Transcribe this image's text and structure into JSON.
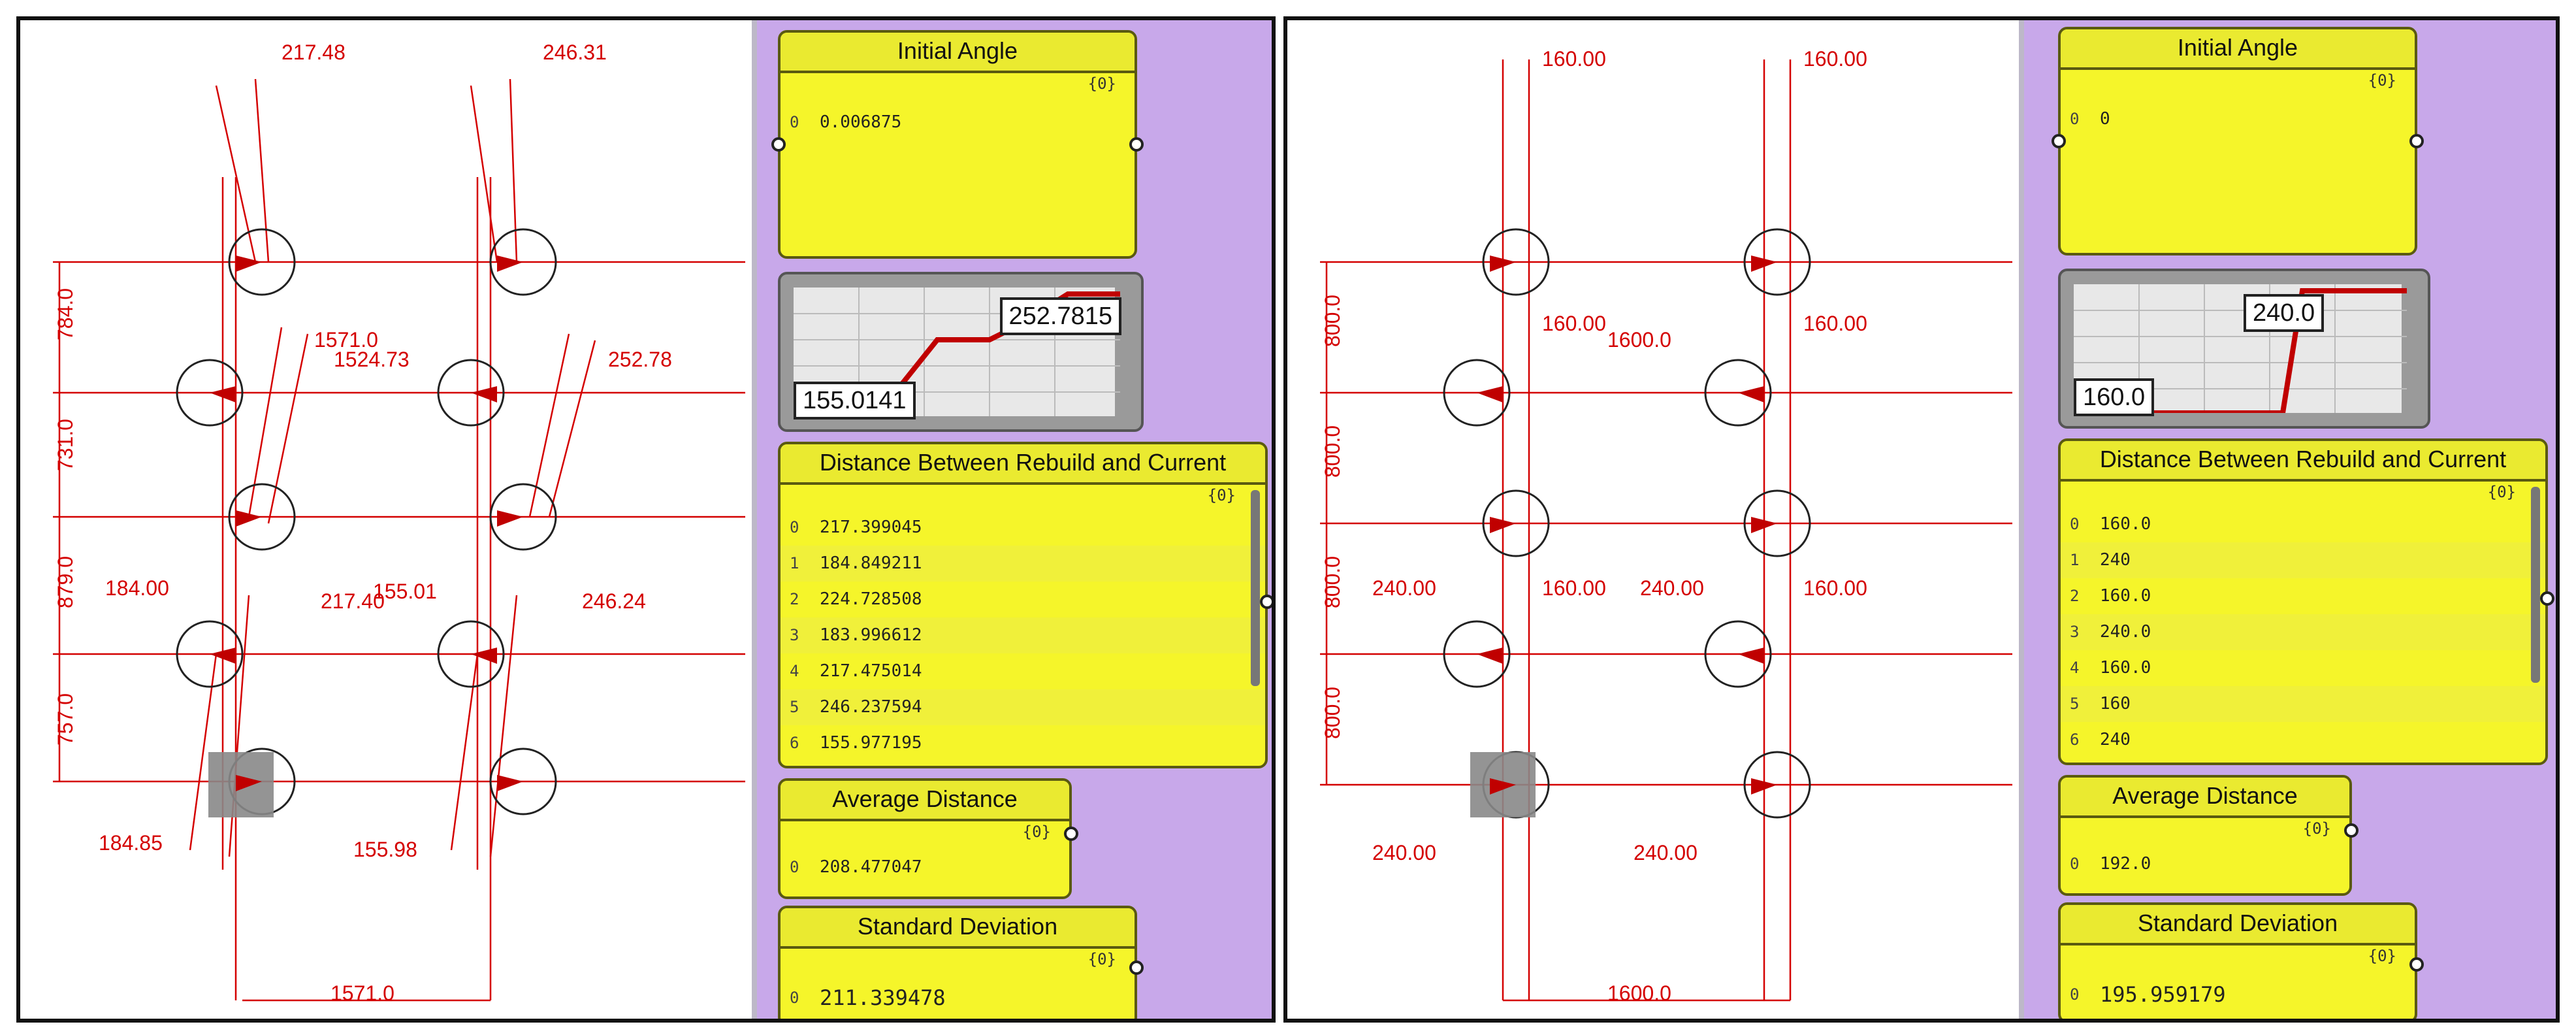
{
  "left": {
    "dims_top": [
      "217.48",
      "246.31"
    ],
    "dims_mid": [
      "1571.0",
      "1524.73",
      "252.78"
    ],
    "dims_low": [
      "184.00",
      "217.40",
      "155.01",
      "246.24"
    ],
    "dims_bottom": [
      "184.85",
      "155.98"
    ],
    "dims_vertical": [
      "784.0",
      "731.0",
      "879.0",
      "757.0"
    ],
    "dim_width": "1571.0",
    "initial_angle": {
      "title": "Initial Angle",
      "path": "{0}",
      "rows": [
        {
          "i": "0",
          "v": "0.006875"
        }
      ]
    },
    "graph": {
      "min_label": "155.0141",
      "max_label": "252.7815"
    },
    "distance": {
      "title": "Distance Between Rebuild and Current",
      "path": "{0}",
      "rows": [
        {
          "i": "0",
          "v": "217.399045"
        },
        {
          "i": "1",
          "v": "184.849211"
        },
        {
          "i": "2",
          "v": "224.728508"
        },
        {
          "i": "3",
          "v": "183.996612"
        },
        {
          "i": "4",
          "v": "217.475014"
        },
        {
          "i": "5",
          "v": "246.237594"
        },
        {
          "i": "6",
          "v": "155.977195"
        }
      ]
    },
    "average": {
      "title": "Average Distance",
      "path": "{0}",
      "rows": [
        {
          "i": "0",
          "v": "208.477047"
        }
      ]
    },
    "stddev": {
      "title": "Standard Deviation",
      "path": "{0}",
      "rows": [
        {
          "i": "0",
          "v": "211.339478"
        }
      ]
    }
  },
  "right": {
    "dims_top": [
      "160.00",
      "160.00"
    ],
    "dims_mid": [
      "160.00",
      "1600.0",
      "160.00"
    ],
    "dims_low": [
      "240.00",
      "160.00",
      "240.00",
      "160.00"
    ],
    "dims_bottom": [
      "240.00",
      "240.00"
    ],
    "dims_vertical": [
      "800.0",
      "800.0",
      "800.0",
      "800.0"
    ],
    "dim_width": "1600.0",
    "initial_angle": {
      "title": "Initial Angle",
      "path": "{0}",
      "rows": [
        {
          "i": "0",
          "v": "0"
        }
      ]
    },
    "graph": {
      "min_label": "160.0",
      "max_label": "240.0"
    },
    "distance": {
      "title": "Distance Between Rebuild and Current",
      "path": "{0}",
      "rows": [
        {
          "i": "0",
          "v": "160.0"
        },
        {
          "i": "1",
          "v": "240"
        },
        {
          "i": "2",
          "v": "160.0"
        },
        {
          "i": "3",
          "v": "240.0"
        },
        {
          "i": "4",
          "v": "160.0"
        },
        {
          "i": "5",
          "v": "160"
        },
        {
          "i": "6",
          "v": "240"
        }
      ]
    },
    "average": {
      "title": "Average Distance",
      "path": "{0}",
      "rows": [
        {
          "i": "0",
          "v": "192.0"
        }
      ]
    },
    "stddev": {
      "title": "Standard Deviation",
      "path": "{0}",
      "rows": [
        {
          "i": "0",
          "v": "195.959179"
        }
      ]
    }
  },
  "colors": {
    "annotation": "#d40000",
    "node": "#f5f52a",
    "canvas": "#c8a8ea"
  }
}
